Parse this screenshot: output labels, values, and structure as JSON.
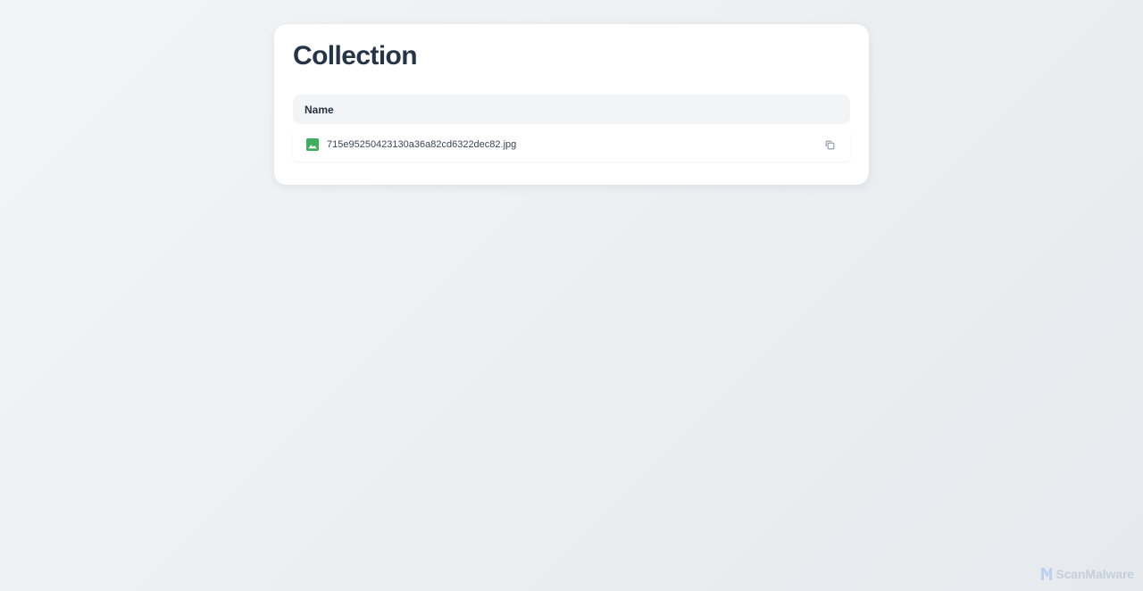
{
  "page": {
    "title": "Collection"
  },
  "table": {
    "columns": [
      "Name"
    ],
    "rows": [
      {
        "name": "715e95250423130a36a82cd6322dec82.jpg",
        "type_icon": "image-icon",
        "action_icon": "copy-icon"
      }
    ]
  },
  "branding": {
    "logo_text": "ScanMalware",
    "logo_icon": "scanmalware-logo-icon"
  },
  "colors": {
    "title_text": "#273445",
    "image_icon": "#3fae5e",
    "header_bg": "#f3f4f6",
    "brand_text": "#c5cfdc",
    "brand_mark": "#bdd0ee"
  }
}
